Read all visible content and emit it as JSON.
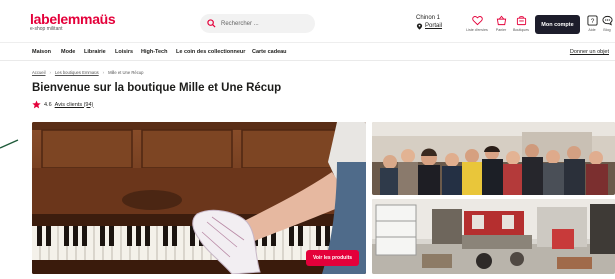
{
  "brand": {
    "logo_text_a": "label",
    "logo_text_b": "emmaüs",
    "logo_sub": "e-shop militant",
    "accent_color": "#e4003a"
  },
  "search": {
    "placeholder": "Rechercher ..."
  },
  "location": {
    "city": "Chinon 1",
    "link": "Portail"
  },
  "header_icons": [
    {
      "icon": "heart-icon",
      "label": "Liste d'envies"
    },
    {
      "icon": "basket-icon",
      "label": "Panier"
    },
    {
      "icon": "bag-icon",
      "label": "Boutiques"
    }
  ],
  "account": {
    "label": "Mon compte"
  },
  "help": {
    "label": "Aide",
    "blog_label": "Blog"
  },
  "nav": {
    "items": [
      "Maison",
      "Mode",
      "Librairie",
      "Loisirs",
      "High-Tech",
      "Le coin des collectionneur",
      "Carte cadeau"
    ],
    "right_link": "Donner un objet"
  },
  "breadcrumb": {
    "items": [
      "Accueil",
      "Les boutiques Emmaüs",
      "Mille et Une Récup"
    ]
  },
  "page": {
    "title": "Bienvenue sur la boutique Mille et Une Récup"
  },
  "rating": {
    "score": "4.6",
    "link": "Avis clients (94)"
  },
  "cta": {
    "label": "Voir les produits"
  }
}
